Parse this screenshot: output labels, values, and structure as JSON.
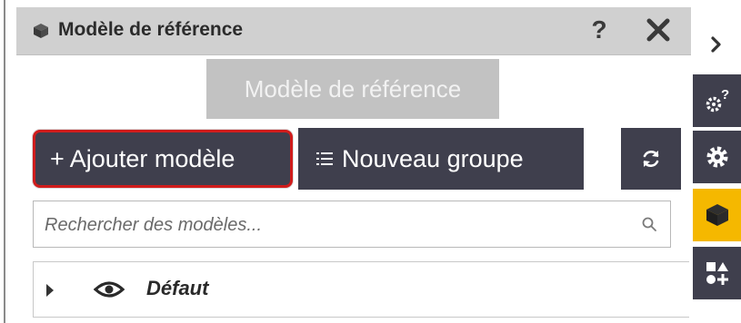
{
  "panel": {
    "title": "Modèle de référence",
    "title_icon": "cube-icon",
    "help_label": "?",
    "close_icon": "close-icon"
  },
  "reference_button": {
    "label": "Modèle de référence"
  },
  "toolbar": {
    "add_model_label": "+ Ajouter modèle",
    "new_group_label": "Nouveau groupe",
    "refresh_icon": "refresh-icon"
  },
  "search": {
    "placeholder": "Rechercher des modèles..."
  },
  "tree": {
    "items": [
      {
        "label": "Défaut",
        "icon": "eye-icon",
        "expanded": false
      }
    ]
  },
  "sidebar": {
    "expand_icon": "chevron-right-icon",
    "items": [
      {
        "icon": "help-settings-icon",
        "active": false
      },
      {
        "icon": "gear-icon",
        "active": false
      },
      {
        "icon": "cube-icon",
        "active": true
      },
      {
        "icon": "shapes-add-icon",
        "active": false
      }
    ]
  },
  "colors": {
    "title_bar": "#d0d0d0",
    "button_dark": "#3f3f4d",
    "button_disabled": "#c2c2c2",
    "highlight_border": "#d01c1c",
    "active_accent": "#f5b800"
  }
}
